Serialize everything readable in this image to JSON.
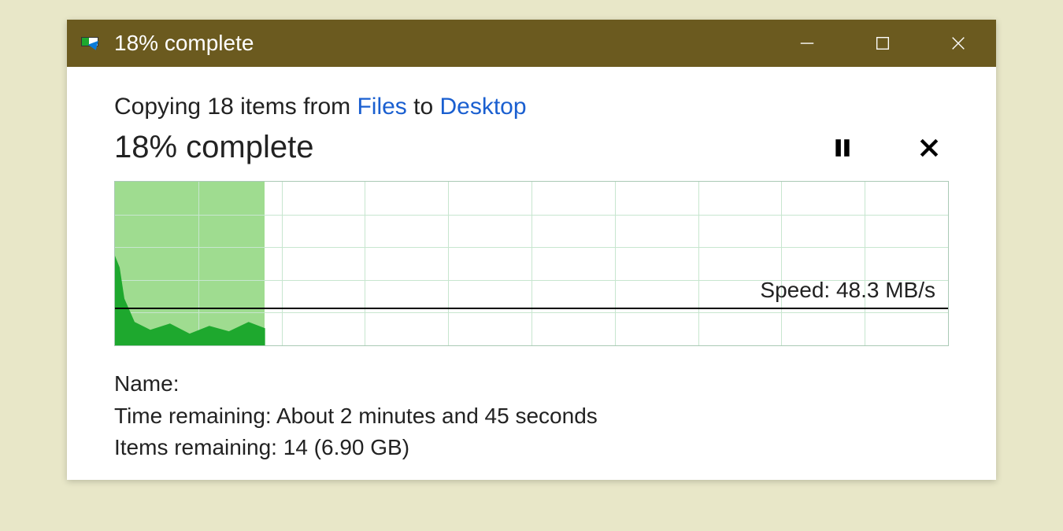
{
  "titlebar": {
    "title": "18% complete"
  },
  "copy": {
    "prefix": "Copying 18 items from ",
    "source": "Files",
    "middle": " to ",
    "destination": "Desktop"
  },
  "status": {
    "percent_complete": "18% complete"
  },
  "graph": {
    "progress_percent": 18,
    "speed_label": "Speed: 48.3 MB/s",
    "grid_cols": 10,
    "grid_rows": 5
  },
  "details": {
    "name_label": "Name:",
    "name_value": "",
    "time_remaining_label": "Time remaining:  ",
    "time_remaining_value": "About 2 minutes and 45 seconds",
    "items_remaining_label": "Items remaining:  ",
    "items_remaining_value": "14 (6.90 GB)"
  }
}
